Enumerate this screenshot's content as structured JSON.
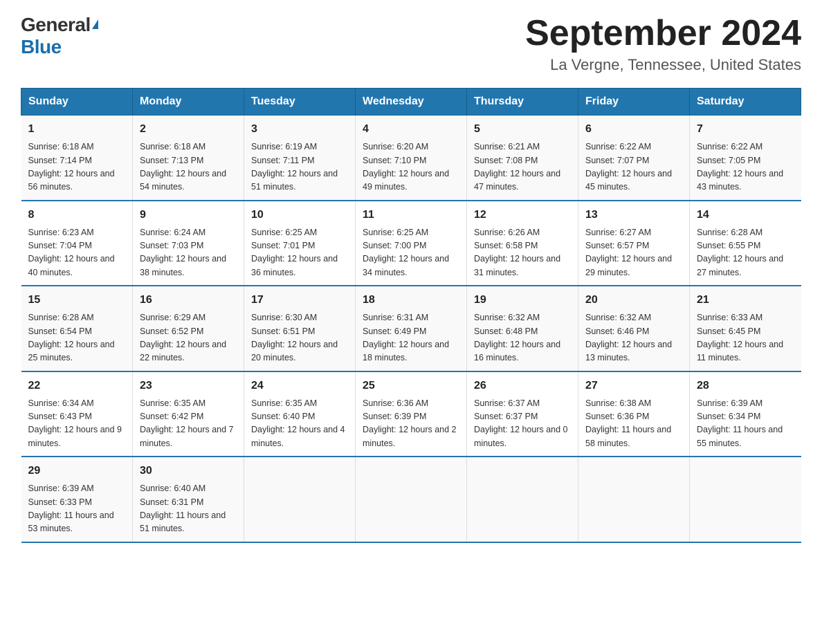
{
  "header": {
    "logo_general": "General",
    "logo_blue": "Blue",
    "title": "September 2024",
    "subtitle": "La Vergne, Tennessee, United States"
  },
  "days_of_week": [
    "Sunday",
    "Monday",
    "Tuesday",
    "Wednesday",
    "Thursday",
    "Friday",
    "Saturday"
  ],
  "weeks": [
    [
      {
        "date": "1",
        "sunrise": "6:18 AM",
        "sunset": "7:14 PM",
        "daylight": "12 hours and 56 minutes."
      },
      {
        "date": "2",
        "sunrise": "6:18 AM",
        "sunset": "7:13 PM",
        "daylight": "12 hours and 54 minutes."
      },
      {
        "date": "3",
        "sunrise": "6:19 AM",
        "sunset": "7:11 PM",
        "daylight": "12 hours and 51 minutes."
      },
      {
        "date": "4",
        "sunrise": "6:20 AM",
        "sunset": "7:10 PM",
        "daylight": "12 hours and 49 minutes."
      },
      {
        "date": "5",
        "sunrise": "6:21 AM",
        "sunset": "7:08 PM",
        "daylight": "12 hours and 47 minutes."
      },
      {
        "date": "6",
        "sunrise": "6:22 AM",
        "sunset": "7:07 PM",
        "daylight": "12 hours and 45 minutes."
      },
      {
        "date": "7",
        "sunrise": "6:22 AM",
        "sunset": "7:05 PM",
        "daylight": "12 hours and 43 minutes."
      }
    ],
    [
      {
        "date": "8",
        "sunrise": "6:23 AM",
        "sunset": "7:04 PM",
        "daylight": "12 hours and 40 minutes."
      },
      {
        "date": "9",
        "sunrise": "6:24 AM",
        "sunset": "7:03 PM",
        "daylight": "12 hours and 38 minutes."
      },
      {
        "date": "10",
        "sunrise": "6:25 AM",
        "sunset": "7:01 PM",
        "daylight": "12 hours and 36 minutes."
      },
      {
        "date": "11",
        "sunrise": "6:25 AM",
        "sunset": "7:00 PM",
        "daylight": "12 hours and 34 minutes."
      },
      {
        "date": "12",
        "sunrise": "6:26 AM",
        "sunset": "6:58 PM",
        "daylight": "12 hours and 31 minutes."
      },
      {
        "date": "13",
        "sunrise": "6:27 AM",
        "sunset": "6:57 PM",
        "daylight": "12 hours and 29 minutes."
      },
      {
        "date": "14",
        "sunrise": "6:28 AM",
        "sunset": "6:55 PM",
        "daylight": "12 hours and 27 minutes."
      }
    ],
    [
      {
        "date": "15",
        "sunrise": "6:28 AM",
        "sunset": "6:54 PM",
        "daylight": "12 hours and 25 minutes."
      },
      {
        "date": "16",
        "sunrise": "6:29 AM",
        "sunset": "6:52 PM",
        "daylight": "12 hours and 22 minutes."
      },
      {
        "date": "17",
        "sunrise": "6:30 AM",
        "sunset": "6:51 PM",
        "daylight": "12 hours and 20 minutes."
      },
      {
        "date": "18",
        "sunrise": "6:31 AM",
        "sunset": "6:49 PM",
        "daylight": "12 hours and 18 minutes."
      },
      {
        "date": "19",
        "sunrise": "6:32 AM",
        "sunset": "6:48 PM",
        "daylight": "12 hours and 16 minutes."
      },
      {
        "date": "20",
        "sunrise": "6:32 AM",
        "sunset": "6:46 PM",
        "daylight": "12 hours and 13 minutes."
      },
      {
        "date": "21",
        "sunrise": "6:33 AM",
        "sunset": "6:45 PM",
        "daylight": "12 hours and 11 minutes."
      }
    ],
    [
      {
        "date": "22",
        "sunrise": "6:34 AM",
        "sunset": "6:43 PM",
        "daylight": "12 hours and 9 minutes."
      },
      {
        "date": "23",
        "sunrise": "6:35 AM",
        "sunset": "6:42 PM",
        "daylight": "12 hours and 7 minutes."
      },
      {
        "date": "24",
        "sunrise": "6:35 AM",
        "sunset": "6:40 PM",
        "daylight": "12 hours and 4 minutes."
      },
      {
        "date": "25",
        "sunrise": "6:36 AM",
        "sunset": "6:39 PM",
        "daylight": "12 hours and 2 minutes."
      },
      {
        "date": "26",
        "sunrise": "6:37 AM",
        "sunset": "6:37 PM",
        "daylight": "12 hours and 0 minutes."
      },
      {
        "date": "27",
        "sunrise": "6:38 AM",
        "sunset": "6:36 PM",
        "daylight": "11 hours and 58 minutes."
      },
      {
        "date": "28",
        "sunrise": "6:39 AM",
        "sunset": "6:34 PM",
        "daylight": "11 hours and 55 minutes."
      }
    ],
    [
      {
        "date": "29",
        "sunrise": "6:39 AM",
        "sunset": "6:33 PM",
        "daylight": "11 hours and 53 minutes."
      },
      {
        "date": "30",
        "sunrise": "6:40 AM",
        "sunset": "6:31 PM",
        "daylight": "11 hours and 51 minutes."
      },
      {
        "date": "",
        "sunrise": "",
        "sunset": "",
        "daylight": ""
      },
      {
        "date": "",
        "sunrise": "",
        "sunset": "",
        "daylight": ""
      },
      {
        "date": "",
        "sunrise": "",
        "sunset": "",
        "daylight": ""
      },
      {
        "date": "",
        "sunrise": "",
        "sunset": "",
        "daylight": ""
      },
      {
        "date": "",
        "sunrise": "",
        "sunset": "",
        "daylight": ""
      }
    ]
  ]
}
